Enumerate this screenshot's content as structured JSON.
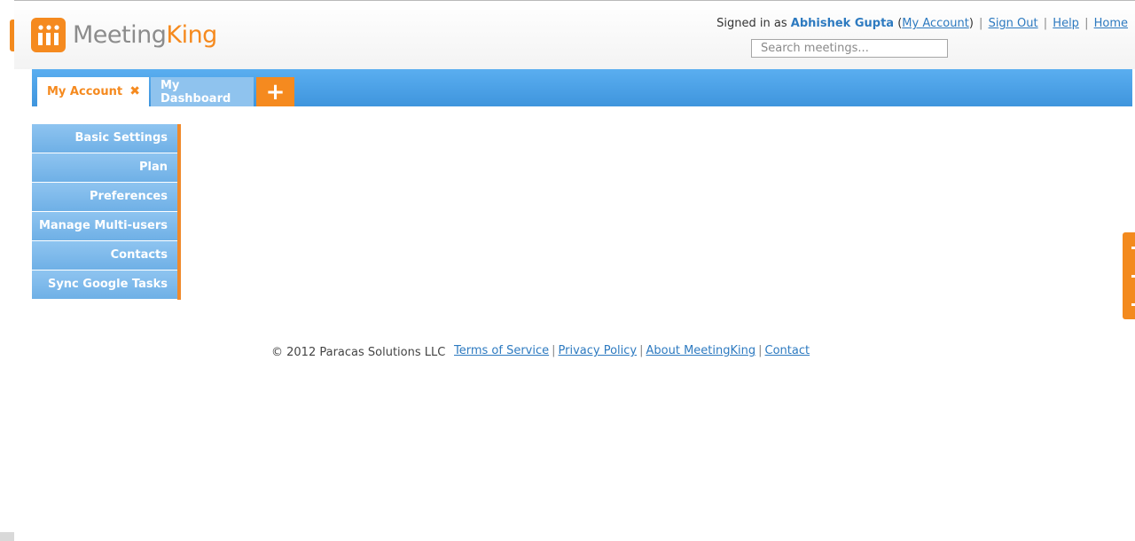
{
  "brand": {
    "name_part1": "Meeting",
    "name_part2": "King",
    "colors": {
      "orange": "#f58a1f",
      "blue": "#2d7ac0",
      "tab_blue": "#4a9ee6"
    }
  },
  "account": {
    "signed_in_prefix": "Signed in as",
    "user_name": "Abhishek Gupta",
    "my_account_link": "My Account",
    "sign_out": "Sign Out",
    "help": "Help",
    "home": "Home"
  },
  "search": {
    "placeholder": "Search meetings..."
  },
  "tabs": [
    {
      "label": "My Account",
      "active": true,
      "close_icon": "close-x-icon"
    },
    {
      "label": "My Dashboard",
      "active": false
    },
    {
      "label": "+",
      "icon": "add-icon"
    }
  ],
  "sidebar": {
    "items": [
      {
        "label": "Basic Settings"
      },
      {
        "label": "Plan"
      },
      {
        "label": "Preferences"
      },
      {
        "label": "Manage Multi-users"
      },
      {
        "label": "Contacts"
      },
      {
        "label": "Sync Google Tasks"
      }
    ]
  },
  "footer": {
    "copyright": "© 2012 Paracas Solutions LLC",
    "links": [
      "Terms of Service",
      "Privacy Policy",
      "About MeetingKing",
      "Contact"
    ]
  }
}
